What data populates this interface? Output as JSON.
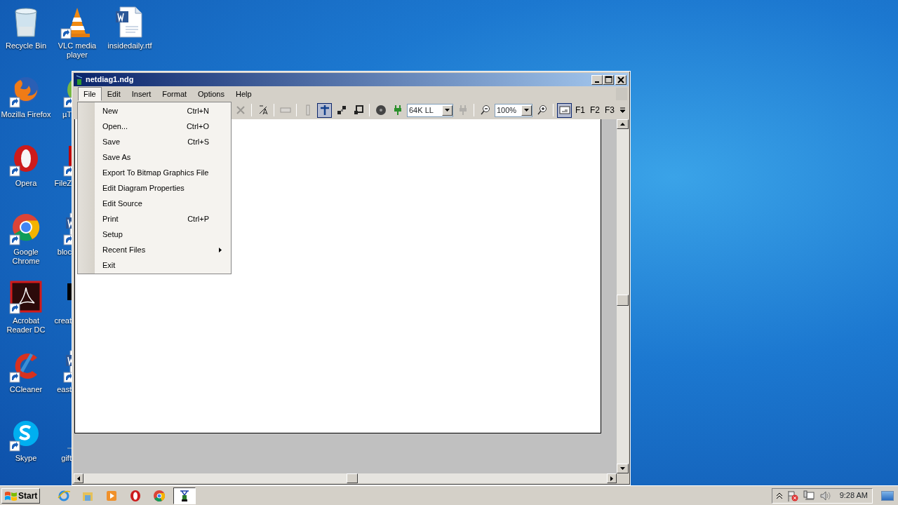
{
  "desktop": {
    "columns": [
      {
        "icons": [
          {
            "kind": "bin",
            "label": "Recycle Bin",
            "shortcut": false,
            "cut": false
          },
          {
            "kind": "firefox",
            "label": "Mozilla Firefox",
            "shortcut": true,
            "cut": false
          },
          {
            "kind": "opera",
            "label": "Opera",
            "shortcut": true,
            "cut": false
          },
          {
            "kind": "chrome",
            "label": "Google Chrome",
            "shortcut": true,
            "cut": false
          },
          {
            "kind": "acrobat",
            "label": "Acrobat Reader DC",
            "shortcut": true,
            "cut": false
          },
          {
            "kind": "ccleaner",
            "label": "CCleaner",
            "shortcut": true,
            "cut": false
          },
          {
            "kind": "skype",
            "label": "Skype",
            "shortcut": true,
            "cut": false
          }
        ]
      },
      {
        "icons": [
          {
            "kind": "vlc",
            "label": "VLC media player",
            "shortcut": true,
            "cut": false
          },
          {
            "kind": "torrent",
            "label": "µT",
            "shortcut": true,
            "cut": true
          },
          {
            "kind": "filezilla",
            "label": "FileZ",
            "shortcut": true,
            "cut": true
          },
          {
            "kind": "word",
            "label": "bloc",
            "shortcut": true,
            "cut": true
          },
          {
            "kind": "black",
            "label": "creat",
            "shortcut": false,
            "cut": true
          },
          {
            "kind": "word",
            "label": "east",
            "shortcut": true,
            "cut": true
          },
          {
            "kind": "blank",
            "label": "gift",
            "shortcut": false,
            "cut": true
          }
        ]
      },
      {
        "icons": [
          {
            "kind": "word",
            "label": "insidedaily.rtf",
            "shortcut": false,
            "cut": false
          }
        ]
      }
    ]
  },
  "window": {
    "title": "netdiag1.ndg",
    "menus": [
      {
        "label": "File",
        "selected": true
      },
      {
        "label": "Edit",
        "selected": false
      },
      {
        "label": "Insert",
        "selected": false
      },
      {
        "label": "Format",
        "selected": false
      },
      {
        "label": "Options",
        "selected": false
      },
      {
        "label": "Help",
        "selected": false
      }
    ],
    "toolbar": [
      {
        "kind": "delete",
        "disabled": true,
        "selected": false
      },
      {
        "kind": "separator"
      },
      {
        "kind": "text-style",
        "disabled": false,
        "selected": false
      },
      {
        "kind": "separator"
      },
      {
        "kind": "label",
        "disabled": true,
        "selected": false
      },
      {
        "kind": "separator"
      },
      {
        "kind": "bar",
        "disabled": true,
        "selected": false
      },
      {
        "kind": "pointer",
        "disabled": false,
        "selected": true
      },
      {
        "kind": "group",
        "disabled": false,
        "selected": false
      },
      {
        "kind": "resize",
        "disabled": false,
        "selected": false
      },
      {
        "kind": "separator"
      },
      {
        "kind": "node",
        "disabled": false,
        "selected": false
      },
      {
        "kind": "plug",
        "disabled": false,
        "selected": false
      },
      {
        "kind": "combo",
        "value": "64K LL"
      },
      {
        "kind": "unplug",
        "disabled": true,
        "selected": false
      },
      {
        "kind": "separator"
      },
      {
        "kind": "zoom-out",
        "disabled": false,
        "selected": false
      },
      {
        "kind": "combo",
        "value": "100%"
      },
      {
        "kind": "zoom-in",
        "disabled": false,
        "selected": false
      },
      {
        "kind": "separator"
      },
      {
        "kind": "frame",
        "disabled": false,
        "selected": true
      },
      {
        "kind": "key",
        "label": "F1"
      },
      {
        "kind": "key",
        "label": "F2"
      },
      {
        "kind": "key",
        "label": "F3"
      }
    ],
    "file_menu": [
      {
        "label": "New",
        "shortcut": "Ctrl+N",
        "submenu": false
      },
      {
        "label": "Open...",
        "shortcut": "Ctrl+O",
        "submenu": false
      },
      {
        "label": "Save",
        "shortcut": "Ctrl+S",
        "submenu": false
      },
      {
        "label": "Save As",
        "submenu": false
      },
      {
        "label": "Export To Bitmap Graphics File",
        "submenu": false
      },
      {
        "label": "Edit Diagram Properties",
        "submenu": false
      },
      {
        "label": "Edit Source",
        "submenu": false
      },
      {
        "label": "Print",
        "shortcut": "Ctrl+P",
        "submenu": false
      },
      {
        "label": "Setup",
        "submenu": false
      },
      {
        "label": "Recent Files",
        "submenu": true
      },
      {
        "label": "Exit",
        "submenu": false
      }
    ]
  },
  "taskbar": {
    "start": "Start",
    "apps": [
      {
        "kind": "ie",
        "active": false
      },
      {
        "kind": "explorer",
        "active": false
      },
      {
        "kind": "media",
        "active": false
      },
      {
        "kind": "opera",
        "active": false
      },
      {
        "kind": "chrome",
        "active": false
      },
      {
        "kind": "netdiag",
        "active": true
      }
    ],
    "tray": {
      "clock": "9:28 AM"
    }
  }
}
